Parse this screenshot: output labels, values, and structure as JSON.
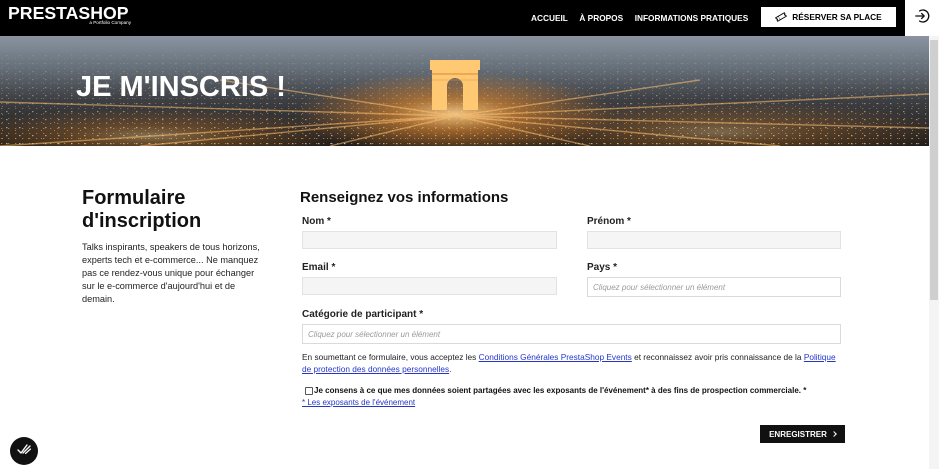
{
  "colors": {
    "nav_background": "#000000",
    "link": "#2536c9",
    "button_background": "#111111"
  },
  "header": {
    "logo": "PRESTASHOP",
    "logo_tagline": "a Portfolio Company",
    "nav": [
      {
        "label": "ACCUEIL"
      },
      {
        "label": "À PROPOS"
      },
      {
        "label": "INFORMATIONS PRATIQUES"
      }
    ],
    "cta": {
      "label": "RÉSERVER SA PLACE",
      "icon": "ticket-icon"
    },
    "login_icon": "login-icon"
  },
  "hero": {
    "title": "JE M'INSCRIS !"
  },
  "intro": {
    "title": "Formulaire d'inscription",
    "description": "Talks inspirants, speakers de tous horizons, experts tech et e-commerce... Ne manquez pas ce rendez-vous unique pour échanger sur le e-commerce d'aujourd'hui et de demain."
  },
  "form": {
    "title": "Renseignez vos informations",
    "fields": {
      "nom": {
        "label": "Nom *"
      },
      "prenom": {
        "label": "Prénom *"
      },
      "email": {
        "label": "Email *"
      },
      "pays": {
        "label": "Pays *",
        "placeholder": "Cliquez pour sélectionner un élément"
      },
      "categorie": {
        "label": "Catégorie de participant *",
        "placeholder": "Cliquez pour sélectionner un élément"
      }
    },
    "legal": {
      "text_before": "En soumettant ce formulaire, vous acceptez les",
      "terms_link": "Conditions Générales PrestaShop Events",
      "text_middle": "et reconnaissez avoir pris connaissance de la",
      "privacy_link": "Politique de protection des données personnelles",
      "text_after": "."
    },
    "consent": {
      "checked": false,
      "label": "Je consens à ce que mes données soient partagées avec les exposants de l'événement* à des fins de prospection commerciale.",
      "required_marker": "*",
      "exhibitors_link": "* Les exposants de l'événement"
    },
    "submit": {
      "label": "ENREGISTRER",
      "icon": "chevron-right-icon"
    }
  },
  "widget": {
    "icon": "consent-widget-icon"
  }
}
